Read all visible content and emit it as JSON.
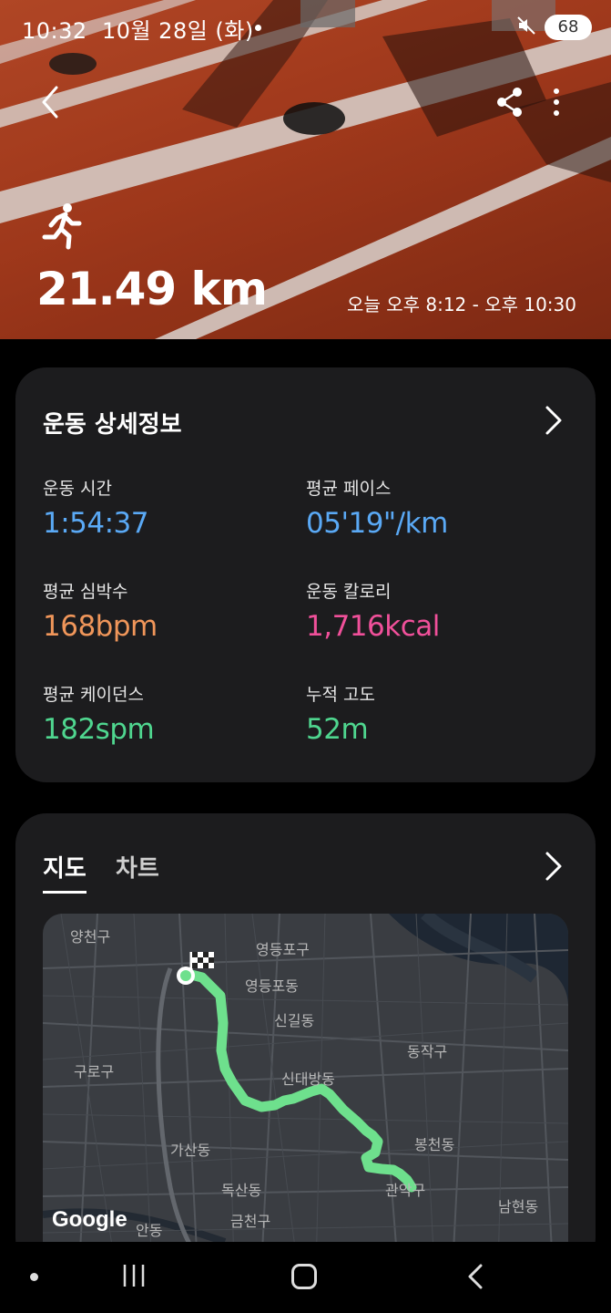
{
  "status_bar": {
    "time": "10:32",
    "date": "10월 28일 (화)",
    "battery": "68"
  },
  "hero": {
    "distance": "21.49 km",
    "time_range": "오늘 오후 8:12 - 오후 10:30",
    "activity_icon": "running-icon"
  },
  "details": {
    "title": "운동 상세정보",
    "stats": [
      {
        "label": "운동 시간",
        "value": "1:54:37",
        "color": "#5aa9f5"
      },
      {
        "label": "평균 페이스",
        "value": "05'19\"/km",
        "color": "#5aa9f5"
      },
      {
        "label": "평균 심박수",
        "value": "168bpm",
        "color": "#f0965a"
      },
      {
        "label": "운동 칼로리",
        "value": "1,716kcal",
        "color": "#f0509a"
      },
      {
        "label": "평균 케이던스",
        "value": "182spm",
        "color": "#4fd68f"
      },
      {
        "label": "누적 고도",
        "value": "52m",
        "color": "#4fd68f"
      }
    ]
  },
  "map_card": {
    "tabs": [
      "지도",
      "차트"
    ],
    "active_tab": "지도",
    "google_logo": "Google",
    "route_color": "#6ee08d",
    "places": [
      "양천구",
      "영등포구",
      "영등포동",
      "신길동",
      "구로구",
      "동작구",
      "신대방동",
      "가산동",
      "봉천동",
      "관악구",
      "독산동",
      "금천구",
      "남현동",
      "안동"
    ]
  },
  "colors": {
    "card_bg": "#1c1c1e",
    "accent_blue": "#5aa9f5",
    "accent_orange": "#f0965a",
    "accent_pink": "#f0509a",
    "accent_green": "#4fd68f"
  }
}
